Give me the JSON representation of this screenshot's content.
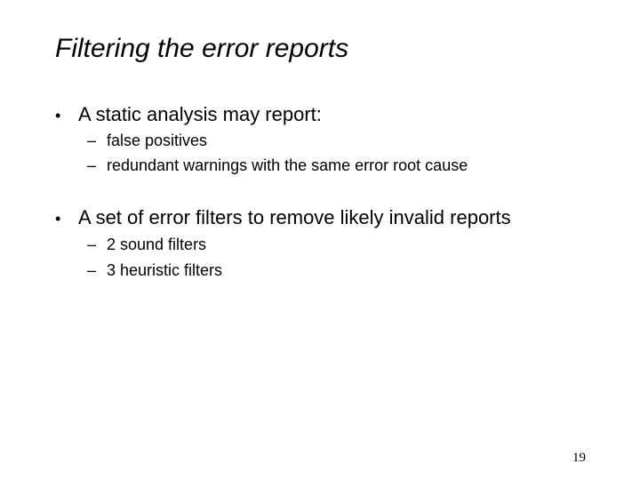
{
  "slide": {
    "title": "Filtering the error reports",
    "bullets": [
      {
        "marker": "•",
        "text": "A static analysis may report:",
        "subitems": [
          {
            "marker": "–",
            "text": "false positives"
          },
          {
            "marker": "–",
            "text": "redundant warnings with the same error root cause"
          }
        ]
      },
      {
        "marker": "•",
        "text": "A set of error filters to remove likely invalid reports",
        "subitems": [
          {
            "marker": "–",
            "text": "2 sound filters"
          },
          {
            "marker": "–",
            "text": "3 heuristic filters"
          }
        ]
      }
    ],
    "page_number": "19"
  }
}
